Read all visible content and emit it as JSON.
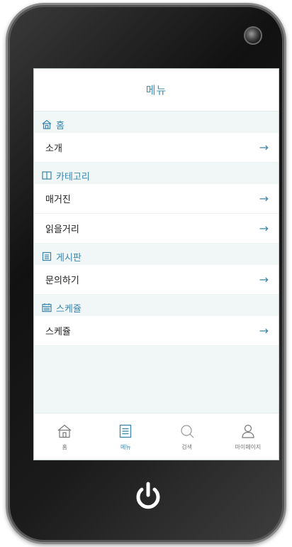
{
  "header": {
    "title": "메뉴"
  },
  "sections": [
    {
      "title": "홈",
      "icon": "home-icon",
      "items": [
        {
          "label": "소개"
        }
      ]
    },
    {
      "title": "카테고리",
      "icon": "book-icon",
      "items": [
        {
          "label": "매거진"
        },
        {
          "label": "읽을거리"
        }
      ]
    },
    {
      "title": "게시판",
      "icon": "board-icon",
      "items": [
        {
          "label": "문의하기"
        }
      ]
    },
    {
      "title": "스케쥴",
      "icon": "calendar-icon",
      "items": [
        {
          "label": "스케쥴"
        }
      ]
    }
  ],
  "item_arrow": "→",
  "tabs": [
    {
      "label": "홈",
      "icon": "home-icon"
    },
    {
      "label": "메뉴",
      "icon": "menu-icon",
      "active": true
    },
    {
      "label": "검색",
      "icon": "search-icon"
    },
    {
      "label": "마이페이지",
      "icon": "user-icon"
    }
  ],
  "colors": {
    "accent": "#3a86ad",
    "screen_bg": "#f1f6f6",
    "power": "#ffffff"
  }
}
